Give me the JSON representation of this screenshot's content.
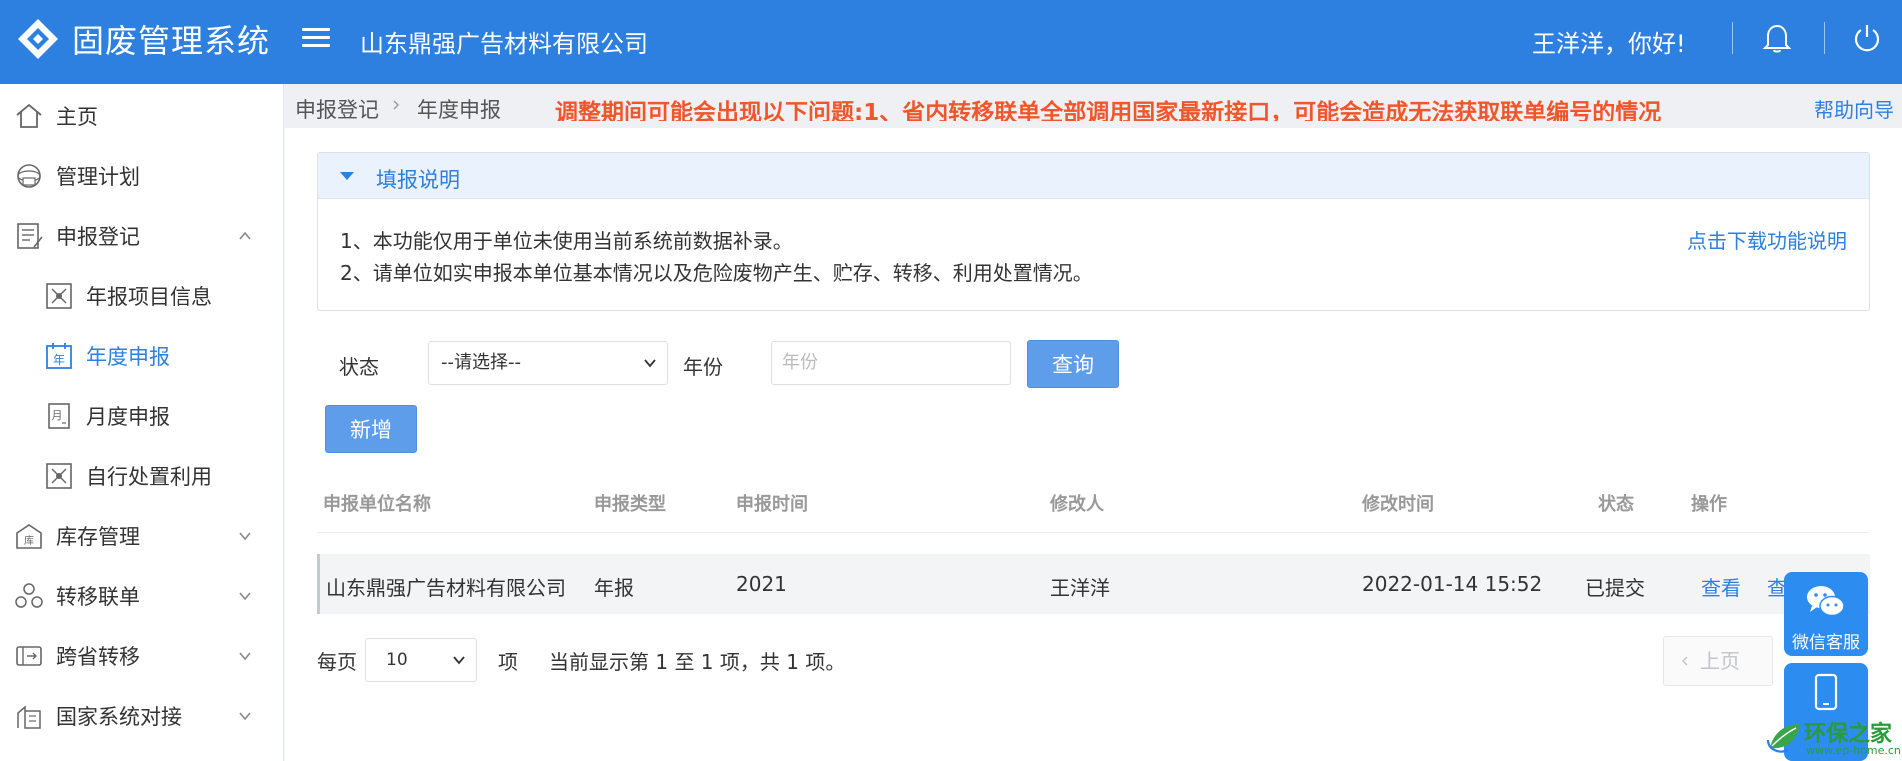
{
  "header": {
    "app_title": "固废管理系统",
    "company": "山东鼎强广告材料有限公司",
    "greeting": "王洋洋，你好!"
  },
  "sidebar": {
    "items": [
      {
        "label": "主页",
        "icon": "home-icon"
      },
      {
        "label": "管理计划",
        "icon": "plan-icon"
      },
      {
        "label": "申报登记",
        "icon": "register-icon",
        "expanded": true
      },
      {
        "label": "年报项目信息",
        "icon": "project-icon"
      },
      {
        "label": "年度申报",
        "icon": "year-icon",
        "active": true
      },
      {
        "label": "月度申报",
        "icon": "month-icon"
      },
      {
        "label": "自行处置利用",
        "icon": "dispose-icon"
      },
      {
        "label": "库存管理",
        "icon": "warehouse-icon"
      },
      {
        "label": "转移联单",
        "icon": "transfer-icon"
      },
      {
        "label": "跨省转移",
        "icon": "cross-province-icon"
      },
      {
        "label": "国家系统对接",
        "icon": "national-system-icon"
      }
    ]
  },
  "breadcrumb": {
    "items": [
      "申报登记",
      "年度申报"
    ],
    "notice": "调整期间可能会出现以下问题:1、省内转移联单全部调用国家最新接口，可能会造成无法获取联单编号的情况",
    "help": "帮助向导"
  },
  "panel": {
    "title": "填报说明",
    "lines": [
      "1、本功能仅用于单位未使用当前系统前数据补录。",
      "2、请单位如实申报本单位基本情况以及危险废物产生、贮存、转移、利用处置情况。"
    ],
    "download_link": "点击下载功能说明"
  },
  "filters": {
    "status_label": "状态",
    "status_value": "--请选择--",
    "year_label": "年份",
    "year_placeholder": "年份",
    "query_button": "查询",
    "add_button": "新增"
  },
  "table": {
    "columns": [
      "申报单位名称",
      "申报类型",
      "申报时间",
      "修改人",
      "修改时间",
      "状态",
      "操作"
    ],
    "rows": [
      {
        "unit": "山东鼎强广告材料有限公司",
        "type": "年报",
        "time": "2021",
        "modifier": "王洋洋",
        "modified_at": "2022-01-14 15:52",
        "status": "已提交",
        "actions": [
          "查看",
          "查"
        ]
      }
    ]
  },
  "pagination": {
    "per_page_label": "每页",
    "per_page_value": "10",
    "unit": "项",
    "summary": "当前显示第 1 至 1 项，共 1 项。",
    "prev": "上页"
  },
  "floating": {
    "wechat_label": "微信客服"
  },
  "watermark": {
    "text": "环保之家",
    "sub": "www.ep-home.cn"
  },
  "colors": {
    "brand": "#2d7fe0",
    "notice": "#f0562c",
    "button": "#5d9de9"
  }
}
